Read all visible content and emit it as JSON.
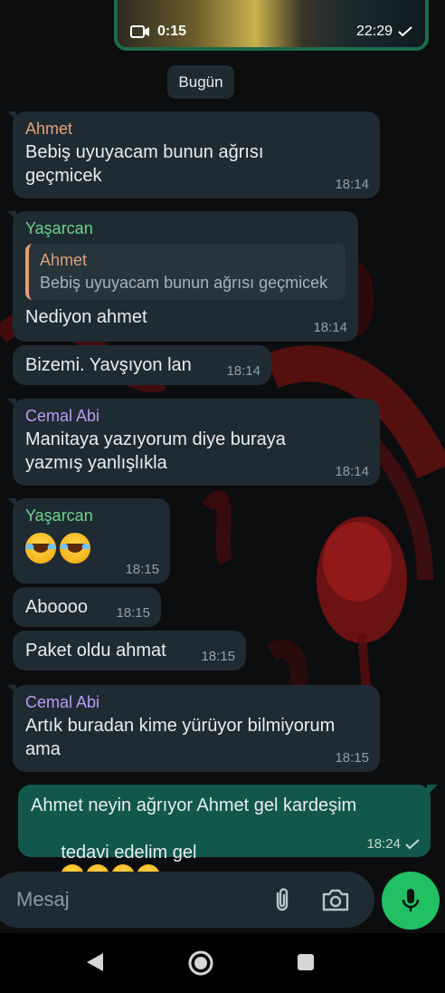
{
  "media": {
    "duration": "0:15",
    "time": "22:29"
  },
  "date_chip": "Bugün",
  "messages": [
    {
      "sender": "Ahmet",
      "text": "Bebiş uyuyacam bunun ağrısı\ngeçmicek",
      "time": "18:14"
    },
    {
      "sender": "Yaşarcan",
      "quote_sender": "Ahmet",
      "quote_text": "Bebiş uyuyacam bunun ağrısı geçmicek",
      "text": "Nediyon ahmet",
      "time": "18:14"
    },
    {
      "text": "Bizemi. Yavşıyon lan",
      "time": "18:14"
    },
    {
      "sender": "Cemal Abi",
      "text": "Manitaya yazıyorum diye buraya\nyazmış yanlışlıkla",
      "time": "18:14"
    },
    {
      "sender": "Yaşarcan",
      "time": "18:15"
    },
    {
      "text": "Aboooo",
      "time": "18:15"
    },
    {
      "text": "Paket oldu ahmat",
      "time": "18:15"
    },
    {
      "sender": "Cemal Abi",
      "text": "Artık buradan kime yürüyor bilmiyorum\nama",
      "time": "18:15"
    }
  ],
  "outgoing": {
    "line1": "Ahmet neyin ağrıyor Ahmet gel kardeşim",
    "line2": "tedavi edelim gel",
    "time": "18:24"
  },
  "input": {
    "placeholder": "Mesaj"
  },
  "colors": {
    "ahmet": "#e1a077",
    "yasarcan": "#6ad58d",
    "cemal": "#b79cf5",
    "outgoing": "#11584a",
    "incoming": "#1f2b32",
    "mic": "#21c063"
  },
  "icons": [
    "video-icon",
    "read-check-icon",
    "attach-icon",
    "camera-icon",
    "mic-icon",
    "back-nav-icon",
    "home-nav-icon",
    "recents-nav-icon",
    "crying-laughing-emoji"
  ]
}
